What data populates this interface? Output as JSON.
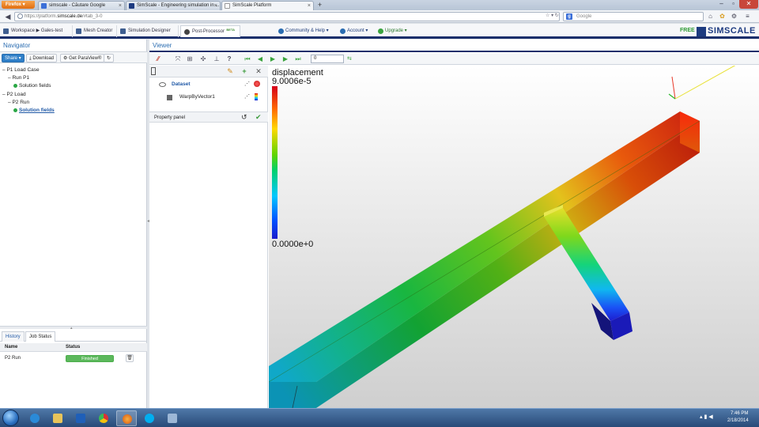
{
  "browser": {
    "app_button": "Firefox",
    "tabs": [
      {
        "title": "simscale - Căutare Google",
        "icon_color": "#3b6fd8"
      },
      {
        "title": "SimScale - Engineering simulation in ...",
        "icon_color": "#1d3b80"
      },
      {
        "title": "SimScale Platform",
        "icon_color": "#ffffff"
      }
    ],
    "new_tab": "+",
    "url_prefix": "https://platform.",
    "url_domain": "simscale.de",
    "url_suffix": "/#tab_3-0",
    "search_placeholder": "Google",
    "search_engine_letter": "g"
  },
  "app": {
    "tabs": [
      {
        "label": "Workspace ▶ Gales-test"
      },
      {
        "label": "Mesh Creator"
      },
      {
        "label": "Simulation Designer"
      },
      {
        "label": "Post-Processor",
        "badge": "BETA"
      }
    ],
    "menus": [
      {
        "label": "Community & Help ▾"
      },
      {
        "label": "Account ▾"
      },
      {
        "label": "Upgrade ▾"
      }
    ],
    "plan": "FREE",
    "brand": "SIMSCALE",
    "colors": {
      "accent": "#1a2f6b",
      "link": "#2a6cb1",
      "success": "#5cb85c"
    }
  },
  "navigator": {
    "title": "Navigator",
    "toolbar": {
      "share": "Share ▾",
      "download": "Download",
      "paraview": "Get ParaView®",
      "refresh": "↻"
    },
    "tree": [
      {
        "label": "P1 Load Case"
      },
      {
        "label": "Run P1"
      },
      {
        "label": "Solution fields"
      },
      {
        "label": "P2 Load"
      },
      {
        "label": "P2 Run"
      },
      {
        "label": "Solution fields"
      }
    ],
    "bottom_tabs": [
      "History",
      "Job Status"
    ],
    "jobs_columns": [
      "Name",
      "Status"
    ],
    "jobs": [
      {
        "name": "P2 Run",
        "status": "Finished"
      }
    ]
  },
  "viewer": {
    "title": "Viewer",
    "frame_value": "0",
    "pipeline": {
      "items": [
        "Dataset",
        "WarpByVector1"
      ],
      "property_panel": "Property panel"
    },
    "legend": {
      "title": "displacement",
      "max": "9.0006e-5",
      "min": "0.0000e+0"
    }
  },
  "taskbar": {
    "time": "7:46 PM",
    "date": "2/18/2014"
  }
}
